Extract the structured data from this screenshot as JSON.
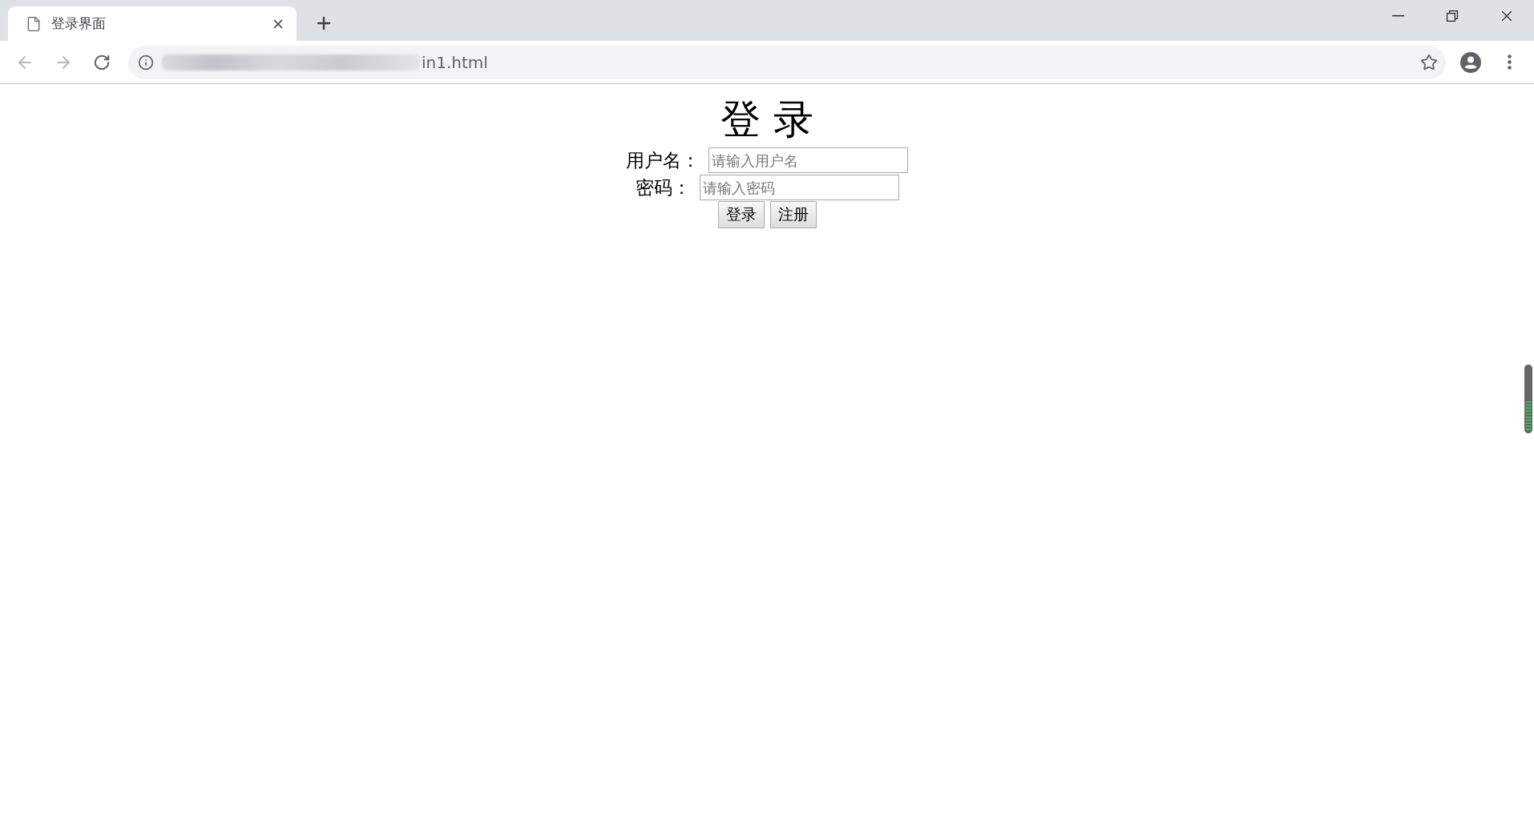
{
  "browser": {
    "tab": {
      "title": "登录界面",
      "selected": true
    },
    "address": {
      "visible_text": "in1.html"
    }
  },
  "page": {
    "heading": "登 录",
    "fields": [
      {
        "label": "用户名：",
        "placeholder": "请输入用户名"
      },
      {
        "label": "密码：",
        "placeholder": "请输入密码"
      }
    ],
    "buttons": [
      "登录",
      "注册"
    ]
  }
}
